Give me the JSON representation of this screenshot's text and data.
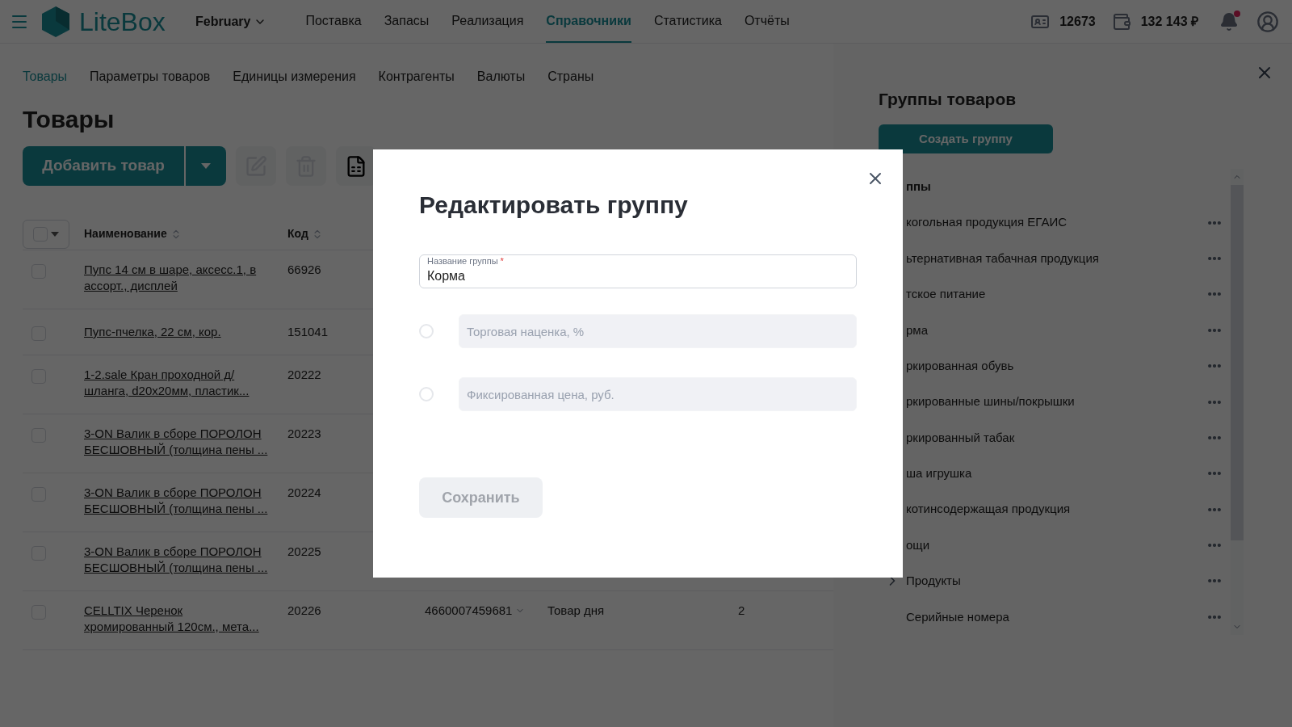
{
  "header": {
    "logo": "LiteBox",
    "period": "February",
    "nav": [
      {
        "label": "Поставка",
        "selected": false
      },
      {
        "label": "Запасы",
        "selected": false
      },
      {
        "label": "Реализация",
        "selected": false
      },
      {
        "label": "Справочники",
        "selected": true
      },
      {
        "label": "Статистика",
        "selected": false
      },
      {
        "label": "Отчёты",
        "selected": false
      }
    ],
    "account_id": "12673",
    "balance": "132 143 ₽",
    "notifications_unread": true
  },
  "subtabs": [
    {
      "label": "Товары",
      "selected": true
    },
    {
      "label": "Параметры товаров",
      "selected": false
    },
    {
      "label": "Единицы измерения",
      "selected": false
    },
    {
      "label": "Контрагенты",
      "selected": false
    },
    {
      "label": "Валюты",
      "selected": false
    },
    {
      "label": "Страны",
      "selected": false
    }
  ],
  "page_title": "Товары",
  "toolbar": {
    "add_button": "Добавить товар",
    "tools": [
      {
        "kind": "edit",
        "disabled": true
      },
      {
        "kind": "delete",
        "disabled": true
      },
      {
        "kind": "document",
        "disabled": false
      }
    ]
  },
  "table": {
    "columns": [
      "Наименование",
      "Код"
    ],
    "rows": [
      {
        "checked": false,
        "name": "Пупс 14 см в шаре, аксесс.1, в ассорт., дисплей",
        "code": "66926"
      },
      {
        "checked": false,
        "name": "Пупс-пчелка, 22 см, кор.",
        "code": "151041"
      },
      {
        "checked": false,
        "name": "1-2.sale Кран проходной д/шланга, d20x20мм, пластик...",
        "code": "20222"
      },
      {
        "checked": false,
        "name": "3-ON Валик в сборе ПОРОЛОН БЕСШОВНЫЙ (толщина пены ...",
        "code": "20223"
      },
      {
        "checked": false,
        "name": "3-ON Валик в сборе ПОРОЛОН БЕСШОВНЫЙ (толщина пены ...",
        "code": "20224"
      },
      {
        "checked": false,
        "name": "3-ON Валик в сборе ПОРОЛОН БЕСШОВНЫЙ (толщина пены ...",
        "code": "20225"
      },
      {
        "checked": false,
        "name": "CELLTIX Черенок хромированный 120см., мета...",
        "code": "20226",
        "column_3": "4660007459681",
        "column_4": "Товар дня",
        "column_5": "2"
      }
    ]
  },
  "groups_panel": {
    "title": "Группы товаров",
    "create_button": "Создать группу",
    "items": [
      {
        "kind": "header",
        "label": "ппы"
      },
      {
        "kind": "group",
        "label": "когольная продукция ЕГАИС"
      },
      {
        "kind": "group",
        "label": "ьтернативная табачная продукция"
      },
      {
        "kind": "group",
        "label": "тское питание"
      },
      {
        "kind": "group",
        "label": "рма"
      },
      {
        "kind": "group",
        "label": "ркированная обувь"
      },
      {
        "kind": "group",
        "label": "ркированные шины/покрышки"
      },
      {
        "kind": "group",
        "label": "ркированный табак"
      },
      {
        "kind": "group",
        "label": "ша игрушка"
      },
      {
        "kind": "group",
        "label": "котинсодержащая продукция"
      },
      {
        "kind": "group",
        "label": "ощи"
      },
      {
        "kind": "parent",
        "label": "Продукты",
        "expanded": false
      },
      {
        "kind": "group",
        "label": "Серийные номера"
      }
    ]
  },
  "modal": {
    "title": "Редактировать группу",
    "name_field": {
      "label": "Название группы",
      "required_mark": "*",
      "value": "Корма"
    },
    "options": [
      {
        "placeholder": "Торговая наценка, %",
        "selected": false
      },
      {
        "placeholder": "Фиксированная цена, руб.",
        "selected": false
      }
    ],
    "save_button": {
      "label": "Сохранить",
      "disabled": true
    }
  }
}
